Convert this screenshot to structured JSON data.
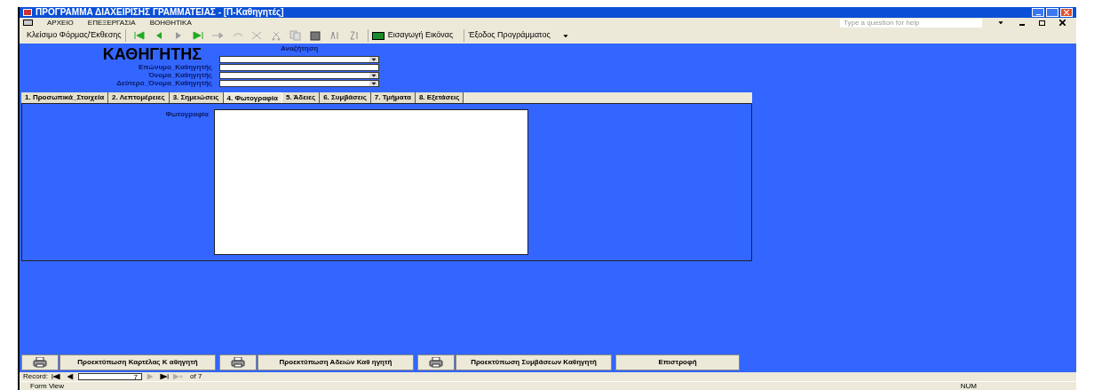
{
  "window": {
    "title": "ΠΡΟΓΡΑΜΜΑ ΔΙΑΧΕΙΡΙΣΗΣ ΓΡΑΜΜΑΤΕΙΑΣ - [Π-Καθηγητές]"
  },
  "menu": [
    "ΑΡΧΕΙΟ",
    "ΕΠΕΞΕΡΓΑΣΙΑ",
    "ΒΟΗΘΗΤΙΚΑ"
  ],
  "help": {
    "placeholder": "Type a question for help"
  },
  "toolbar": {
    "close_form": "Κλείσιμο Φόρμας/Έκθεσης",
    "insert_image": "Εισαγωγή Εικόνας",
    "exit": "Έξοδος Προγράμματος"
  },
  "form": {
    "heading": "ΚΑΘΗΓΗΤΗΣ",
    "search_label": "Αναζήτηση",
    "fields": [
      {
        "label": "Επώνυμο_Καθηγητής",
        "kind": "text"
      },
      {
        "label": "Όνομα_Καθηγητής",
        "kind": "combo"
      },
      {
        "label": "Δεύτερο_Όνομα_Καθηγητής",
        "kind": "combo"
      }
    ],
    "tabs": [
      {
        "label": "1. Προσωπικά_Στοιχεία",
        "selected": false
      },
      {
        "label": "2. Λεπτομέρειες",
        "selected": false
      },
      {
        "label": "3. Σημειώσεις",
        "selected": false
      },
      {
        "label": "4. Φωτογραφία",
        "selected": true
      },
      {
        "label": "5. Άδειες",
        "selected": false
      },
      {
        "label": "6. Συμβάσεις",
        "selected": false
      },
      {
        "label": "7. Τμήματα",
        "selected": false
      },
      {
        "label": "8. Εξετάσεις",
        "selected": false
      }
    ],
    "photo_label": "Φωτογραφία",
    "buttons": [
      {
        "kind": "print",
        "label": "Προεκτύπωση Καρτέλας Κ αθηγητή"
      },
      {
        "kind": "print",
        "label": "Προεκτύπωση Αδειών Καθ ηγητή"
      },
      {
        "kind": "print",
        "label": "Προεκτύπωση Συμβάσεων Καθηγητή"
      },
      {
        "kind": "plain",
        "label": "Επιστροφή"
      }
    ]
  },
  "record_nav": {
    "label": "Record:",
    "current": "7",
    "total": "of 7"
  },
  "status_bar": {
    "mode": "Form View",
    "num": "NUM"
  }
}
